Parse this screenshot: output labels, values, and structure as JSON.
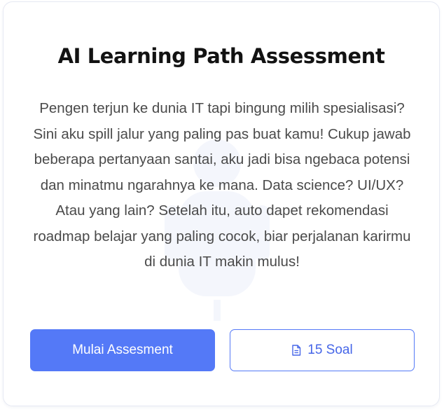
{
  "card": {
    "title": "AI Learning Path Assessment",
    "description": "Pengen terjun ke dunia IT tapi bingung milih spesialisasi? Sini aku spill jalur yang paling pas buat kamu! Cukup jawab beberapa pertanyaan santai, aku jadi bisa ngebaca potensi dan minatmu ngarahnya ke mana. Data science? UI/UX? Atau yang lain? Setelah itu, auto dapet rekomendasi roadmap belajar yang paling cocok, biar perjalanan karirmu di dunia IT makin mulus!",
    "watermark_icon": "robot-icon"
  },
  "actions": {
    "start_label": "Mulai Assesment",
    "questions_label": "15 Soal",
    "questions_icon": "document-icon"
  },
  "colors": {
    "accent": "#5479f7",
    "accent_text": "#4666e8",
    "title": "#121212",
    "body_text": "#4a4a4a",
    "card_border": "#e6e9f3"
  }
}
